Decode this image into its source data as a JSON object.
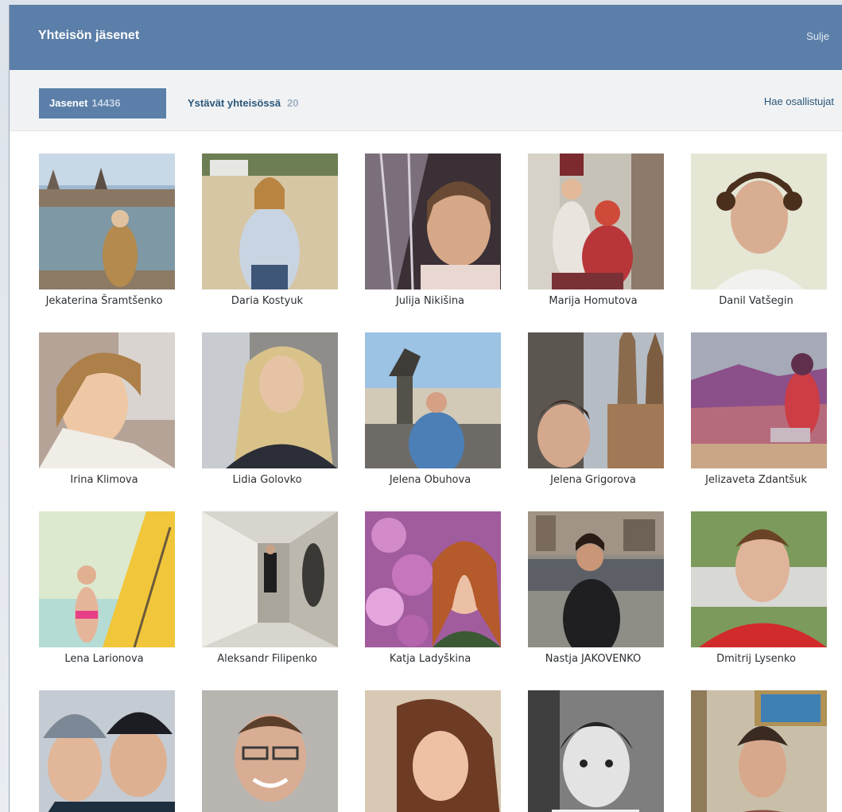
{
  "modal": {
    "title": "Yhteisön jäsenet",
    "close_label": "Sulje"
  },
  "tabs": [
    {
      "label": "Jasenet",
      "count": "14436"
    },
    {
      "label": "Ystävät yhteisössä",
      "count": "20"
    }
  ],
  "search_label": "Hae osallistujat",
  "members": [
    {
      "name": "Jekaterina Šramtšenko",
      "scene": "city-river"
    },
    {
      "name": "Daria Kostyuk",
      "scene": "beach"
    },
    {
      "name": "Julija Nikišina",
      "scene": "indoor-purple"
    },
    {
      "name": "Marija Homutova",
      "scene": "street"
    },
    {
      "name": "Danil Vatšegin",
      "scene": "portrait-light"
    },
    {
      "name": "Irina Klimova",
      "scene": "selfie-warm"
    },
    {
      "name": "Lidia Golovko",
      "scene": "selfie-blonde"
    },
    {
      "name": "Jelena Obuhova",
      "scene": "statue-sky"
    },
    {
      "name": "Jelena Grigorova",
      "scene": "gothic-church"
    },
    {
      "name": "Jelizaveta Zdantšuk",
      "scene": "canyon"
    },
    {
      "name": "Lena Larionova",
      "scene": "surfboard"
    },
    {
      "name": "Aleksandr Filipenko",
      "scene": "corridor"
    },
    {
      "name": "Katja Ladyškina",
      "scene": "lilac"
    },
    {
      "name": "Nastja JAKOVENKO",
      "scene": "city-street"
    },
    {
      "name": "Dmitrij Lysenko",
      "scene": "red-shirt"
    },
    {
      "name": "",
      "scene": "winter-couple"
    },
    {
      "name": "",
      "scene": "glasses-man"
    },
    {
      "name": "",
      "scene": "brunette"
    },
    {
      "name": "",
      "scene": "bw-child"
    },
    {
      "name": "",
      "scene": "painting-wall"
    }
  ]
}
